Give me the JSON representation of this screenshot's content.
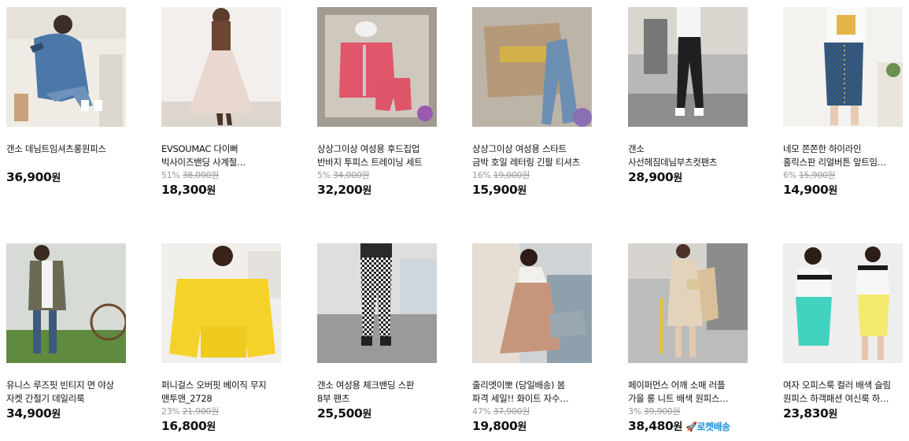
{
  "products": [
    {
      "name_line1": "갠소 데님트임셔츠롱원피스",
      "name_line2": "",
      "discount": "",
      "original_price": "",
      "price": "36,900",
      "currency": "원",
      "rocket": ""
    },
    {
      "name_line1": "EVSOUMAC 다이뻐",
      "name_line2": "빅사이즈밴딩 사계절…",
      "discount": "51%",
      "original_price": "38,000원",
      "price": "18,300",
      "currency": "원",
      "rocket": ""
    },
    {
      "name_line1": "상상그이상 여성용 후드집업",
      "name_line2": "반바지 투피스 트레이닝 세트",
      "discount": "5%",
      "original_price": "34,000원",
      "price": "32,200",
      "currency": "원",
      "rocket": ""
    },
    {
      "name_line1": "상상그이상 여성용 스타트",
      "name_line2": "금박 호일 레터링 긴팔 티셔츠",
      "discount": "16%",
      "original_price": "19,000원",
      "price": "15,900",
      "currency": "원",
      "rocket": ""
    },
    {
      "name_line1": "갠소",
      "name_line2": "사선헤짐데님부츠컷팬츠",
      "discount": "",
      "original_price": "",
      "price": "28,900",
      "currency": "원",
      "rocket": ""
    },
    {
      "name_line1": "네모 쫀쫀한 하이라인",
      "name_line2": "홀릭스판 리얼버튼 앞트임…",
      "discount": "6%",
      "original_price": "15,900원",
      "price": "14,900",
      "currency": "원",
      "rocket": ""
    },
    {
      "name_line1": "유니스 루즈핏 빈티지 면 야상",
      "name_line2": "자켓 간절기 데일리룩",
      "discount": "",
      "original_price": "",
      "price": "34,900",
      "currency": "원",
      "rocket": ""
    },
    {
      "name_line1": "퍼니걸스 오버핏 베이직 무지",
      "name_line2": "맨투맨_2728",
      "discount": "23%",
      "original_price": "21,900원",
      "price": "16,800",
      "currency": "원",
      "rocket": ""
    },
    {
      "name_line1": "갠소 여성용 체크밴딩 스판",
      "name_line2": "8부 팬츠",
      "discount": "",
      "original_price": "",
      "price": "25,500",
      "currency": "원",
      "rocket": ""
    },
    {
      "name_line1": "줄리엣이뽀 (당일배송) 봄",
      "name_line2": "파격 세일!! 화이트 자수…",
      "discount": "47%",
      "original_price": "37,900원",
      "price": "19,800",
      "currency": "원",
      "rocket": ""
    },
    {
      "name_line1": "페이퍼먼스 어깨 소매 러플",
      "name_line2": "가을 롱 니트 배색 원피스…",
      "discount": "3%",
      "original_price": "39,900원",
      "price": "38,480",
      "currency": "원",
      "rocket": "로켓배송"
    },
    {
      "name_line1": "여자 오피스룩 컬러 배색 슬림",
      "name_line2": "원피스 하객패션 여신룩 하…",
      "discount": "",
      "original_price": "",
      "price": "23,830",
      "currency": "원",
      "rocket": ""
    }
  ],
  "colors": {
    "price": "#111111",
    "muted": "#999999",
    "rocket": "#1a8fd6"
  }
}
